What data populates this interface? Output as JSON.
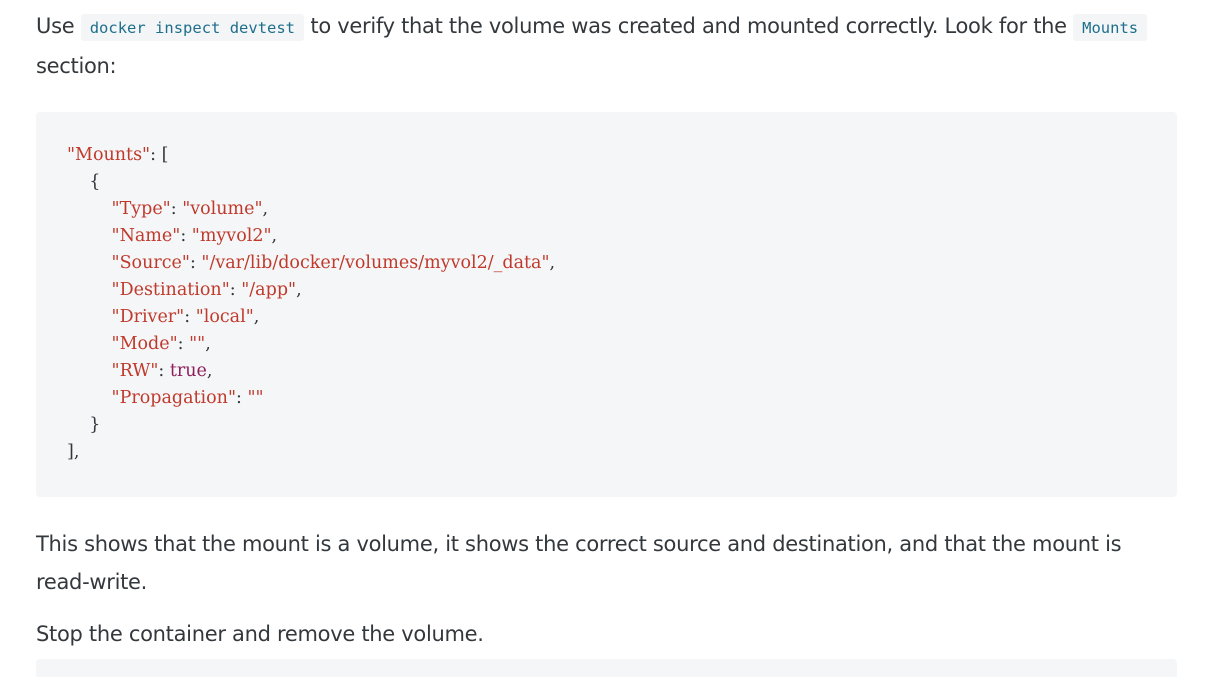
{
  "intro": {
    "before": "Use ",
    "code1": "docker inspect devtest",
    "middle": " to verify that the volume was created and mounted correctly. Look for the ",
    "code2": "Mounts",
    "after": " section:"
  },
  "code_block": {
    "line1_key": "\"Mounts\"",
    "line1_rest": ": [",
    "line2": "    {",
    "lines": [
      {
        "key": "\"Type\"",
        "sep": ": ",
        "value": "\"volume\"",
        "end": ","
      },
      {
        "key": "\"Name\"",
        "sep": ": ",
        "value": "\"myvol2\"",
        "end": ","
      },
      {
        "key": "\"Source\"",
        "sep": ": ",
        "value": "\"/var/lib/docker/volumes/myvol2/_data\"",
        "end": ","
      },
      {
        "key": "\"Destination\"",
        "sep": ": ",
        "value": "\"/app\"",
        "end": ","
      },
      {
        "key": "\"Driver\"",
        "sep": ": ",
        "value": "\"local\"",
        "end": ","
      },
      {
        "key": "\"Mode\"",
        "sep": ": ",
        "value": "\"\"",
        "end": ","
      },
      {
        "key": "\"RW\"",
        "sep": ": ",
        "value": "true",
        "end": ","
      },
      {
        "key": "\"Propagation\"",
        "sep": ": ",
        "value": "\"\"",
        "end": ""
      }
    ],
    "close_brace": "    }",
    "close_bracket": "],"
  },
  "explanation": "This shows that the mount is a volume, it shows the correct source and destination, and that the mount is read-write.",
  "instruction": "Stop the container and remove the volume."
}
